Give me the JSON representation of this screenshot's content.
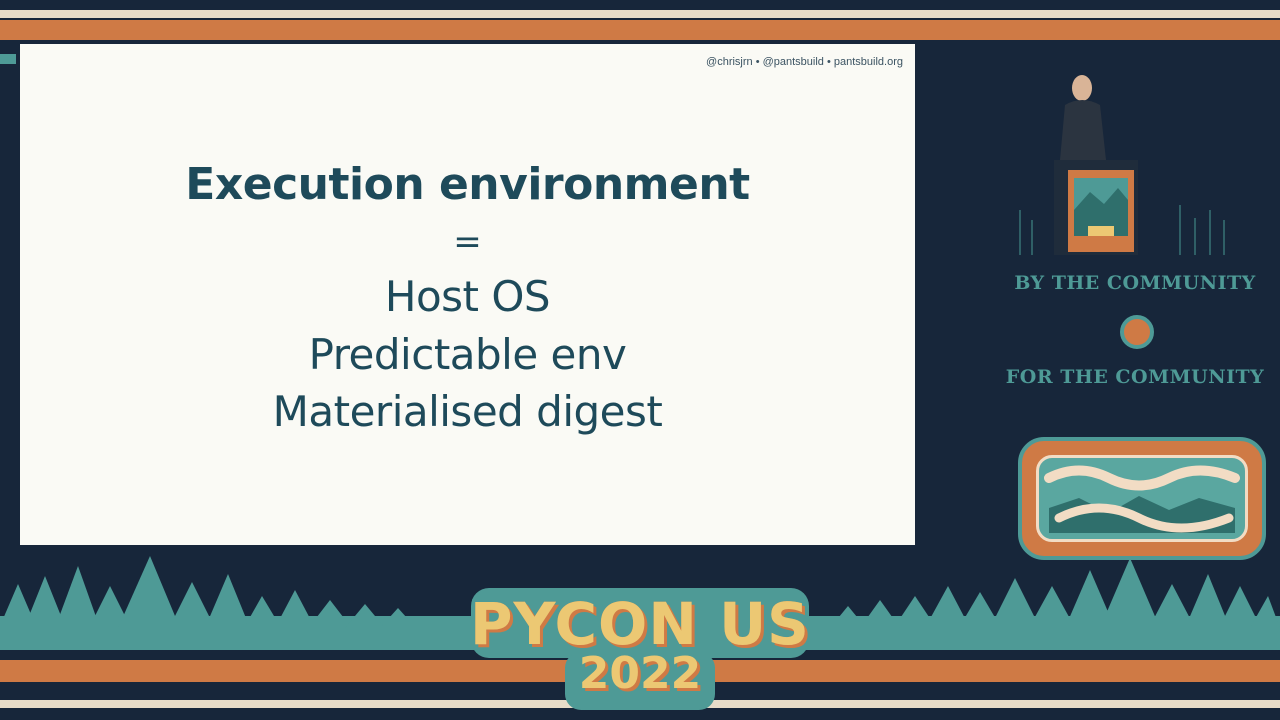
{
  "slide": {
    "credit": "@chrisjrn • @pantsbuild • pantsbuild.org",
    "title": "Execution environment",
    "equals": "=",
    "lines": [
      "Host OS",
      "Predictable env",
      "Materialised digest"
    ]
  },
  "sidebar": {
    "tagline_top": "BY THE COMMUNITY",
    "tagline_bottom": "FOR THE COMMUNITY"
  },
  "event": {
    "name": "PYCON US",
    "year": "2022"
  },
  "colors": {
    "navy": "#17263a",
    "orange": "#cf7a45",
    "teal": "#4e9a96",
    "cream": "#e7dcc8",
    "slide_text": "#1e4a5a"
  }
}
